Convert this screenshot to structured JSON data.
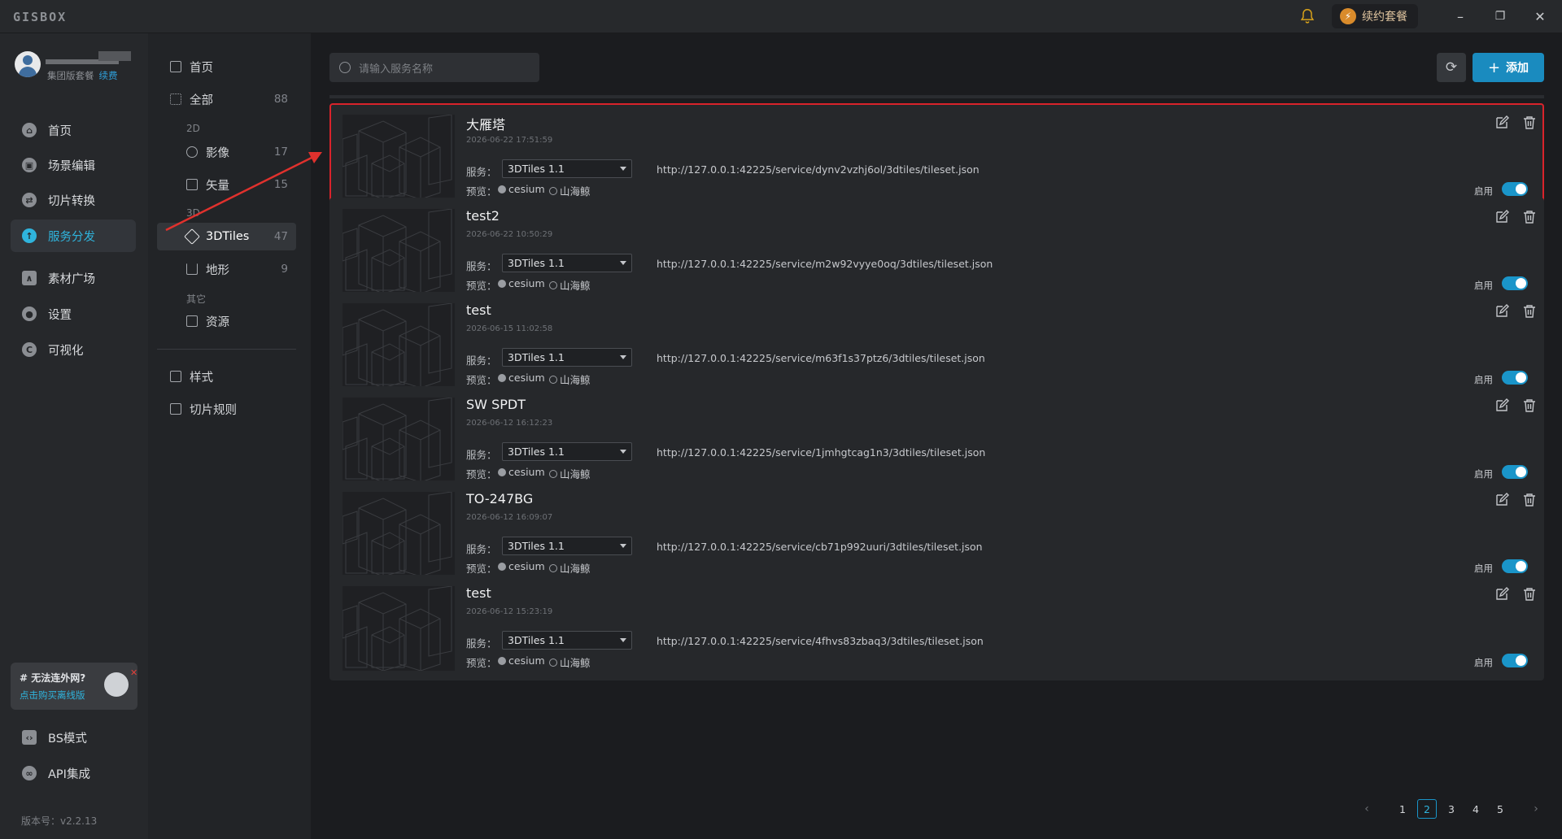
{
  "app": {
    "logo": "GISBOX"
  },
  "titlebar": {
    "renew_label": "续约套餐",
    "minimize": "–",
    "restore": "❐",
    "close": "✕"
  },
  "user": {
    "plan": "集团版套餐",
    "renew": "续费"
  },
  "nav": {
    "items": [
      {
        "label": "首页",
        "icon": "home-icon"
      },
      {
        "label": "场景编辑",
        "icon": "cube-icon"
      },
      {
        "label": "切片转换",
        "icon": "swap-icon"
      },
      {
        "label": "服务分发",
        "icon": "upload-icon",
        "active": true
      },
      {
        "label": "素材广场",
        "icon": "image-icon"
      },
      {
        "label": "设置",
        "icon": "gear-icon"
      },
      {
        "label": "可视化",
        "icon": "chart-icon"
      }
    ],
    "bottom": [
      {
        "label": "BS模式",
        "icon": "code-icon"
      },
      {
        "label": "API集成",
        "icon": "api-icon"
      }
    ],
    "offline": {
      "title": "# 无法连外网?",
      "link": "点击购买离线版"
    },
    "version": "版本号：v2.2.13"
  },
  "subnav": {
    "home": "首页",
    "all": {
      "label": "全部",
      "count": "88"
    },
    "group_2d": "2D",
    "imagery": {
      "label": "影像",
      "count": "17"
    },
    "vector": {
      "label": "矢量",
      "count": "15"
    },
    "group_3d": "3D",
    "tiles3d": {
      "label": "3DTiles",
      "count": "47"
    },
    "terrain": {
      "label": "地形",
      "count": "9"
    },
    "group_other": "其它",
    "resource": {
      "label": "资源"
    },
    "style": "样式",
    "slice_rule": "切片规则"
  },
  "toolbar": {
    "search_placeholder": "请输入服务名称",
    "add_label": "添加"
  },
  "labels": {
    "service": "服务：",
    "preview": "预览：",
    "cesium": "cesium",
    "shanhai": "山海鲸",
    "enable": "启用"
  },
  "services": [
    {
      "name": "大雁塔",
      "time": "2026-06-22 17:51:59",
      "version": "3DTiles 1.1",
      "url": "http://127.0.0.1:42225/service/dynv2vzhj6ol/3dtiles/tileset.json",
      "enabled": true,
      "highlighted": true
    },
    {
      "name": "test2",
      "time": "2026-06-22 10:50:29",
      "version": "3DTiles 1.1",
      "url": "http://127.0.0.1:42225/service/m2w92vyye0oq/3dtiles/tileset.json",
      "enabled": true
    },
    {
      "name": "test",
      "time": "2026-06-15 11:02:58",
      "version": "3DTiles 1.1",
      "url": "http://127.0.0.1:42225/service/m63f1s37ptz6/3dtiles/tileset.json",
      "enabled": true
    },
    {
      "name": "SW SPDT",
      "time": "2026-06-12 16:12:23",
      "version": "3DTiles 1.1",
      "url": "http://127.0.0.1:42225/service/1jmhgtcag1n3/3dtiles/tileset.json",
      "enabled": true
    },
    {
      "name": "TO-247BG",
      "time": "2026-06-12 16:09:07",
      "version": "3DTiles 1.1",
      "url": "http://127.0.0.1:42225/service/cb71p992uuri/3dtiles/tileset.json",
      "enabled": true
    },
    {
      "name": "test",
      "time": "2026-06-12 15:23:19",
      "version": "3DTiles 1.1",
      "url": "http://127.0.0.1:42225/service/4fhvs83zbaq3/3dtiles/tileset.json",
      "enabled": true
    }
  ],
  "pagination": {
    "pages": [
      "1",
      "2",
      "3",
      "4",
      "5"
    ],
    "current": "2",
    "prev": "‹",
    "next": "›"
  },
  "colors": {
    "accent": "#1a95c9",
    "highlight_border": "#d9232b",
    "annotation_arrow": "#e0312d"
  }
}
